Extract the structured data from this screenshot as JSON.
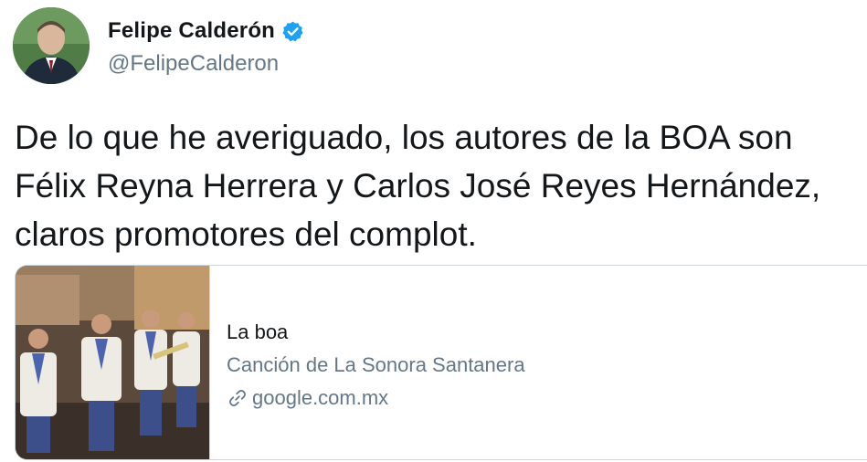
{
  "author": {
    "display_name": "Felipe Calderón",
    "handle": "@FelipeCalderon",
    "verified": true,
    "avatar_icon": "person-portrait"
  },
  "tweet": {
    "text": "De lo que he averiguado, los autores de la BOA son\nFélix Reyna Herrera y Carlos José Reyes Hernández,\nclaros promotores del complot."
  },
  "card": {
    "title": "La boa",
    "description": "Canción de La Sonora Santanera",
    "domain": "google.com.mx",
    "link_icon": "link-icon",
    "image_subject": "band-performing-on-stage"
  },
  "colors": {
    "text_primary": "#14171a",
    "text_secondary": "#657786",
    "verified_blue": "#1da1f2",
    "border": "#ccd6dd"
  }
}
